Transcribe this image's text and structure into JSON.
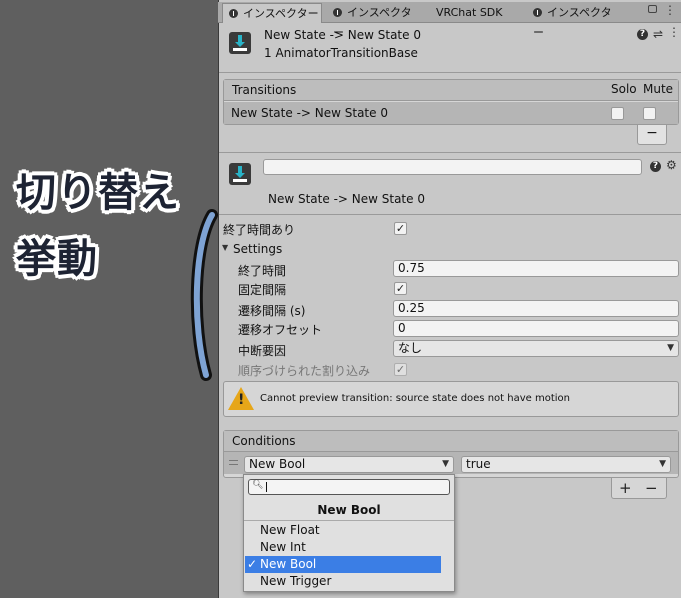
{
  "annotation": {
    "line1": "切り替え",
    "line2": "挙動"
  },
  "tabs": [
    {
      "label": "インスペクター",
      "active": true
    },
    {
      "label": "インスペクター",
      "active": false
    },
    {
      "label": "VRChat SDK",
      "active": false
    },
    {
      "label": "インスペクター",
      "active": false
    }
  ],
  "header": {
    "title": "New State -> New State 0",
    "subtitle": "1 AnimatorTransitionBase"
  },
  "transitions": {
    "title": "Transitions",
    "solo_label": "Solo",
    "mute_label": "Mute",
    "rows": [
      {
        "label": "New State -> New State 0",
        "solo": false,
        "mute": false
      }
    ],
    "remove_label": "−"
  },
  "transition": {
    "name_value": "",
    "label": "New State -> New State 0"
  },
  "properties": {
    "has_exit_time": {
      "label": "終了時間あり",
      "checked": true
    },
    "settings_label": "Settings",
    "exit_time": {
      "label": "終了時間",
      "value": "0.75"
    },
    "fixed_duration": {
      "label": "固定間隔",
      "checked": true
    },
    "transition_duration": {
      "label": "遷移間隔 (s)",
      "value": "0.25"
    },
    "transition_offset": {
      "label": "遷移オフセット",
      "value": "0"
    },
    "interruption_source": {
      "label": "中断要因",
      "value": "なし"
    },
    "ordered_interruption": {
      "label": "順序づけられた割り込み",
      "checked": true
    }
  },
  "warning": {
    "text": "Cannot preview transition: source state does not have motion"
  },
  "conditions": {
    "title": "Conditions",
    "param_value": "New Bool",
    "mode_value": "true",
    "add_label": "+",
    "remove_label": "−"
  },
  "popup": {
    "search_placeholder": "",
    "header": "New Bool",
    "items": [
      {
        "label": "New Float",
        "selected": false
      },
      {
        "label": "New Int",
        "selected": false
      },
      {
        "label": "New Bool",
        "selected": true
      },
      {
        "label": "New Trigger",
        "selected": false
      }
    ],
    "check_mark": "✓"
  },
  "colors": {
    "panel_bg": "#c8c8c8",
    "highlight": "#3b7ee5",
    "annotation_curve": "#7ea3d4",
    "warning": "#e6a619"
  }
}
